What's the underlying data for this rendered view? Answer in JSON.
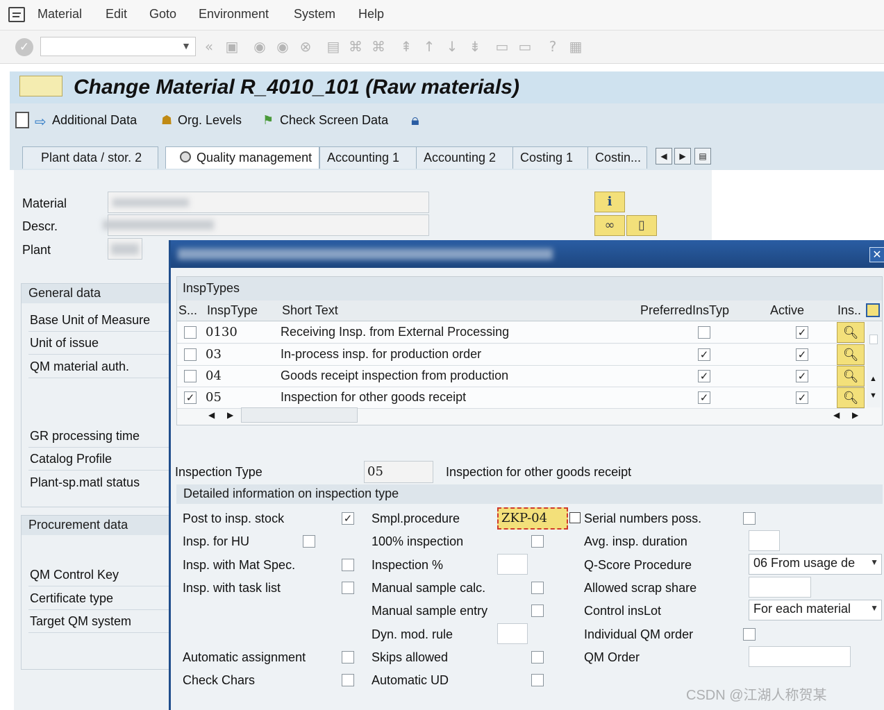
{
  "menu": [
    "Material",
    "Edit",
    "Goto",
    "Environment",
    "System",
    "Help"
  ],
  "title": "Change Material R_4010_101 (Raw materials)",
  "app_toolbar": {
    "additional_data": "Additional Data",
    "org_levels": "Org. Levels",
    "check_screen_data": "Check Screen Data"
  },
  "tabs": [
    "Plant data / stor. 2",
    "Quality management",
    "Accounting 1",
    "Accounting 2",
    "Costing 1",
    "Costin..."
  ],
  "header_fields": {
    "material": "Material",
    "descr": "Descr.",
    "plant": "Plant"
  },
  "general_data": {
    "title": "General data",
    "items": [
      "Base Unit of Measure",
      "Unit of issue",
      "QM material auth.",
      "GR processing time",
      "Catalog Profile",
      "Plant-sp.matl status"
    ]
  },
  "procurement_data": {
    "title": "Procurement data",
    "items": [
      "QM Control Key",
      "Certificate type",
      "Target QM system"
    ]
  },
  "insp_table": {
    "caption": "InspTypes",
    "columns": [
      "S...",
      "InspType",
      "Short Text",
      "PreferredInsTyp",
      "Active",
      "Ins.."
    ],
    "rows": [
      {
        "selected": false,
        "type": "0130",
        "text": "Receiving Insp. from External Processing",
        "preferred": false,
        "active": true
      },
      {
        "selected": false,
        "type": "03",
        "text": "In-process insp. for production order",
        "preferred": true,
        "active": true
      },
      {
        "selected": false,
        "type": "04",
        "text": "Goods receipt inspection from production",
        "preferred": true,
        "active": true
      },
      {
        "selected": true,
        "type": "05",
        "text": "Inspection for other goods receipt",
        "preferred": true,
        "active": true
      }
    ]
  },
  "inspection_type": {
    "label": "Inspection Type",
    "value": "05",
    "description": "Inspection for other goods receipt"
  },
  "detail": {
    "title": "Detailed information on inspection type",
    "col1": [
      {
        "label": "Post to insp. stock",
        "checked": true
      },
      {
        "label": "Insp. for HU",
        "checked": false
      },
      {
        "label": "Insp. with Mat Spec.",
        "checked": false
      },
      {
        "label": "Insp. with task list",
        "checked": false
      },
      {
        "label": "Automatic assignment",
        "checked": false
      },
      {
        "label": "Check Chars",
        "checked": false
      }
    ],
    "col2": {
      "smpl_procedure_label": "Smpl.procedure",
      "smpl_procedure_value": "ZKP-04",
      "insp_100_label": "100% inspection",
      "insp_pct_label": "Inspection %",
      "manual_calc_label": "Manual sample calc.",
      "manual_entry_label": "Manual sample entry",
      "dyn_rule_label": "Dyn. mod. rule",
      "skips_label": "Skips allowed",
      "auto_ud_label": "Automatic UD"
    },
    "col3": {
      "serial_label": "Serial numbers poss.",
      "avg_duration_label": "Avg. insp. duration",
      "qscore_label": "Q-Score Procedure",
      "qscore_value": "06 From usage de",
      "scrap_label": "Allowed scrap share",
      "control_label": "Control insLot",
      "control_value": "For each material",
      "indiv_order_label": "Individual QM order",
      "qm_order_label": "QM Order"
    }
  },
  "watermark": "CSDN @江湖人称贺某",
  "colors": {
    "title_bar": "#cfe2ef",
    "popup_title": "#1d467f",
    "input_highlight": "#f3e07a"
  }
}
